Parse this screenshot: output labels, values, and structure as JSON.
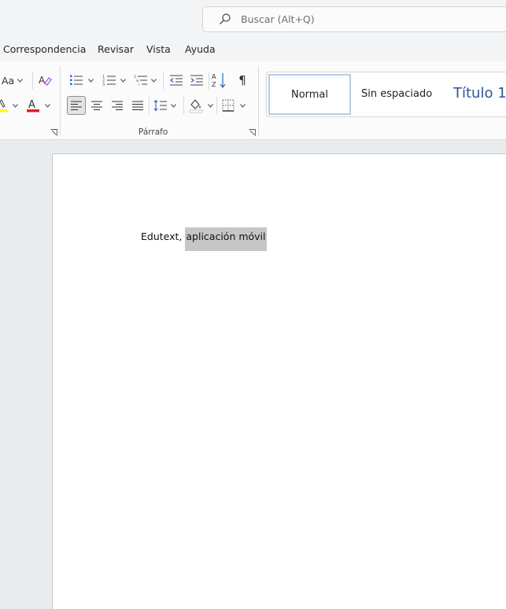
{
  "search": {
    "placeholder": "Buscar (Alt+Q)"
  },
  "menu": {
    "tabs": [
      {
        "label": "Correspondencia"
      },
      {
        "label": "Revisar"
      },
      {
        "label": "Vista"
      },
      {
        "label": "Ayuda"
      }
    ]
  },
  "ribbon": {
    "font_group": {
      "change_case_label": "Aa"
    },
    "paragraph_group": {
      "label": "Párrafo"
    },
    "styles": {
      "items": [
        {
          "label": "Normal",
          "selected": true
        },
        {
          "label": "Sin espaciado"
        },
        {
          "label": "Título 1"
        }
      ]
    },
    "colors": {
      "highlight": "#ffff00",
      "font_color": "#e02020",
      "style_selected_border": "#b8cbe4",
      "title_style": "#2f5596"
    }
  },
  "document": {
    "text_plain": "Edutext, ",
    "text_selected": "aplicación móvil"
  }
}
